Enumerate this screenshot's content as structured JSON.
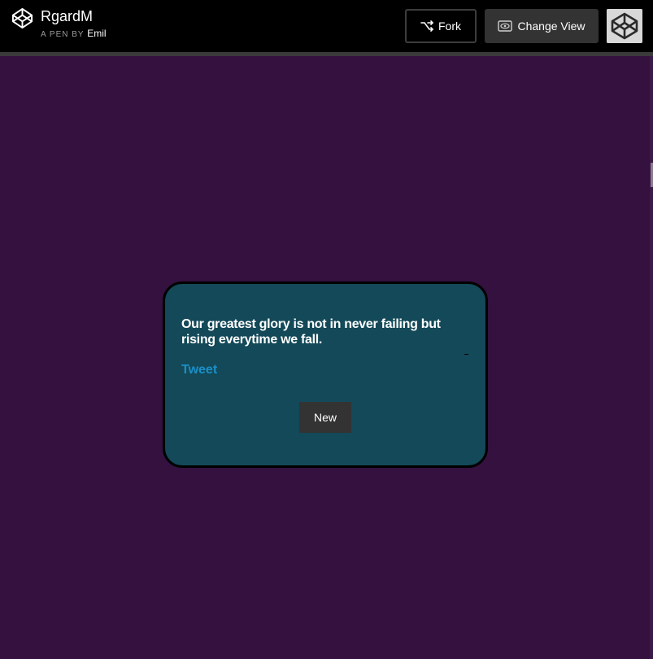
{
  "header": {
    "pen_title": "RgardM",
    "byline_prefix": "A PEN BY",
    "author": "Emil",
    "fork_label": "Fork",
    "change_view_label": "Change View",
    "icons": {
      "logo": "codepen-logo-icon",
      "fork": "fork-icon",
      "change_view": "eye-icon",
      "avatar": "user-avatar"
    }
  },
  "quote_card": {
    "quote": "Our greatest glory is not in never failing but rising everytime we fall.",
    "tweet_label": "Tweet",
    "new_label": "New"
  },
  "colors": {
    "background": "#34113f",
    "card": "#134958",
    "link": "#1b8fc7",
    "topbar": "#000000",
    "button": "#333333"
  }
}
